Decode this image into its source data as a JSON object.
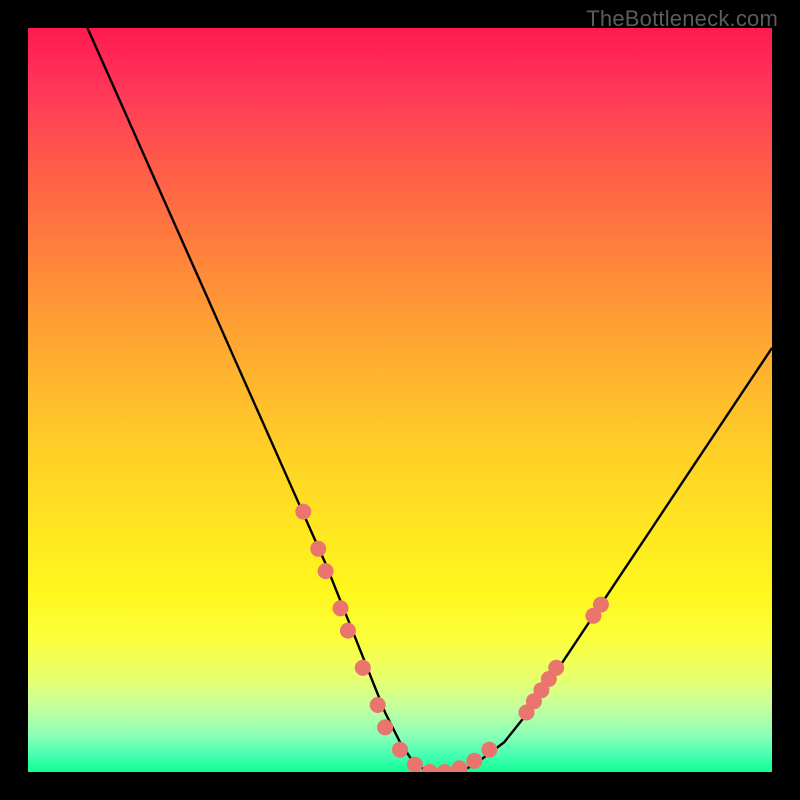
{
  "watermark": "TheBottleneck.com",
  "chart_data": {
    "type": "line",
    "title": "",
    "xlabel": "",
    "ylabel": "",
    "x_range": [
      0,
      100
    ],
    "y_range": [
      0,
      100
    ],
    "series": [
      {
        "name": "bottleneck-curve",
        "x": [
          8,
          12,
          16,
          20,
          24,
          28,
          32,
          36,
          40,
          42,
          44,
          46,
          48,
          50,
          52,
          54,
          56,
          58,
          60,
          64,
          68,
          72,
          76,
          80,
          84,
          88,
          92,
          96,
          100
        ],
        "y": [
          100,
          91,
          82,
          73,
          64,
          55,
          46,
          37,
          28,
          23,
          18,
          13,
          8,
          4,
          1,
          0,
          0,
          0,
          1,
          4,
          9,
          15,
          21,
          27,
          33,
          39,
          45,
          51,
          57
        ]
      }
    ],
    "markers": {
      "name": "highlight-dots",
      "points": [
        {
          "x": 37,
          "y": 35
        },
        {
          "x": 39,
          "y": 30
        },
        {
          "x": 40,
          "y": 27
        },
        {
          "x": 42,
          "y": 22
        },
        {
          "x": 43,
          "y": 19
        },
        {
          "x": 45,
          "y": 14
        },
        {
          "x": 47,
          "y": 9
        },
        {
          "x": 48,
          "y": 6
        },
        {
          "x": 50,
          "y": 3
        },
        {
          "x": 52,
          "y": 1
        },
        {
          "x": 54,
          "y": 0
        },
        {
          "x": 56,
          "y": 0
        },
        {
          "x": 58,
          "y": 0.5
        },
        {
          "x": 60,
          "y": 1.5
        },
        {
          "x": 62,
          "y": 3
        },
        {
          "x": 67,
          "y": 8
        },
        {
          "x": 68,
          "y": 9.5
        },
        {
          "x": 69,
          "y": 11
        },
        {
          "x": 70,
          "y": 12.5
        },
        {
          "x": 71,
          "y": 14
        },
        {
          "x": 76,
          "y": 21
        },
        {
          "x": 77,
          "y": 22.5
        }
      ]
    },
    "gradient_stops": [
      {
        "pos": 0,
        "color": "#ff1a4f"
      },
      {
        "pos": 50,
        "color": "#ffcc26"
      },
      {
        "pos": 80,
        "color": "#ffff30"
      },
      {
        "pos": 100,
        "color": "#0fff90"
      }
    ]
  }
}
